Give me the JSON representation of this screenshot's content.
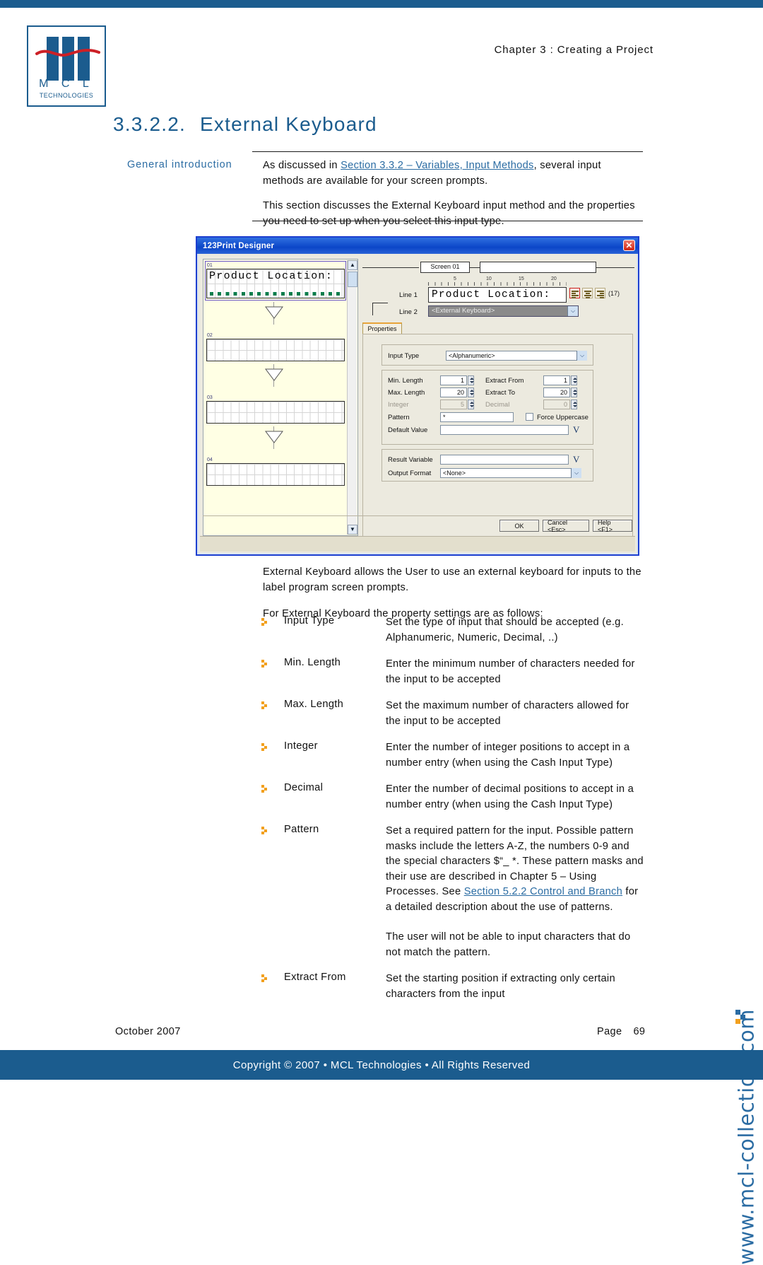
{
  "brand": {
    "accent_blue": "#1b5c8e",
    "link_blue": "#2b6ca3",
    "bullet_orange": "#f2a01e",
    "logo_letters": "M C L",
    "logo_subtitle": "TECHNOLOGIES"
  },
  "header": {
    "running_head": "Chapter 3 : Creating a Project"
  },
  "title": {
    "number": "3.3.2.2.",
    "text": "External Keyboard"
  },
  "intro": {
    "side_label": "General introduction",
    "para1_before": "As discussed in ",
    "para1_link": "Section 3.3.2 – Variables, Input Methods",
    "para1_after": ", several input methods are available for your screen prompts.",
    "para2": "This section discusses the External Keyboard input method and the properties you need to set up when you select this input type."
  },
  "figure": {
    "window_title": "123Print Designer",
    "close_glyph": "✕",
    "preview": {
      "items": [
        {
          "num": "01",
          "text": "Product Location:",
          "selected": true
        },
        {
          "num": "02",
          "text": "",
          "selected": false
        },
        {
          "num": "03",
          "text": "",
          "selected": false
        },
        {
          "num": "04",
          "text": "",
          "selected": false
        }
      ],
      "scroll_up_glyph": "▲",
      "scroll_down_glyph": "▼"
    },
    "editor": {
      "screen_tag": "Screen 01",
      "screen_value": "",
      "ruler_marks": [
        "5",
        "10",
        "15",
        "20"
      ],
      "line1_label": "Line 1",
      "line1_value": "Product Location:",
      "length_badge": "(17)",
      "line2_label": "Line 2",
      "line2_value": "<External Keyboard>",
      "dropdown_glyph": "⌵",
      "tab_label": "Properties"
    },
    "properties": {
      "input_type_label": "Input Type",
      "input_type_value": "<Alphanumeric>",
      "min_length_label": "Min. Length",
      "min_length_value": "1",
      "max_length_label": "Max. Length",
      "max_length_value": "20",
      "integer_label": "Integer",
      "integer_value": "5",
      "extract_from_label": "Extract From",
      "extract_from_value": "1",
      "extract_to_label": "Extract To",
      "extract_to_value": "20",
      "decimal_label": "Decimal",
      "decimal_value": "0",
      "pattern_label": "Pattern",
      "pattern_value": "*",
      "force_uppercase_label": "Force Uppercase",
      "default_value_label": "Default Value",
      "default_value_value": "",
      "result_variable_label": "Result Variable",
      "result_variable_value": "",
      "output_format_label": "Output Format",
      "output_format_value": "<None>",
      "variable_picker_glyph": "V"
    },
    "buttons": {
      "ok": "OK",
      "cancel": "Cancel <Esc>",
      "help": "Help <F1>"
    }
  },
  "post": {
    "para1": "External Keyboard allows the User to use an external keyboard for inputs to the label program screen prompts.",
    "para2": "For External Keyboard the property settings are as follows:"
  },
  "settings": [
    {
      "term": "Input Type",
      "desc": "Set the type of input that should be accepted (e.g. Alphanumeric, Numeric, Decimal, ..)"
    },
    {
      "term": "Min. Length",
      "desc": "Enter the minimum number of characters needed for the input to be accepted"
    },
    {
      "term": "Max. Length",
      "desc": "Set the maximum number of characters allowed for the input to be accepted"
    },
    {
      "term": "Integer",
      "desc": "Enter the number of integer positions to accept in a number entry (when using the Cash Input Type)"
    },
    {
      "term": "Decimal",
      "desc": "Enter the number of decimal positions to accept in a number entry (when using the Cash Input Type)"
    },
    {
      "term": "Pattern",
      "desc_before": "Set a required pattern for the input.  Possible pattern masks include the letters A-Z, the numbers 0-9 and the special characters $“_ *. These pattern masks and their use are described in Chapter 5 – Using Processes. See ",
      "desc_link": "Section 5.2.2 Control and Branch",
      "desc_after": " for a detailed description about the use of patterns.",
      "desc_extra": "The user will not be able to input characters that do not match the pattern."
    },
    {
      "term": "Extract From",
      "desc": "Set the starting position if extracting only certain characters from the input"
    }
  ],
  "watermark": {
    "text": "www.mcl-collection.com"
  },
  "footer": {
    "date": "October 2007",
    "page_label": "Page",
    "page_number": "69",
    "copyright": "Copyright © 2007 • MCL Technologies • All Rights Reserved"
  }
}
